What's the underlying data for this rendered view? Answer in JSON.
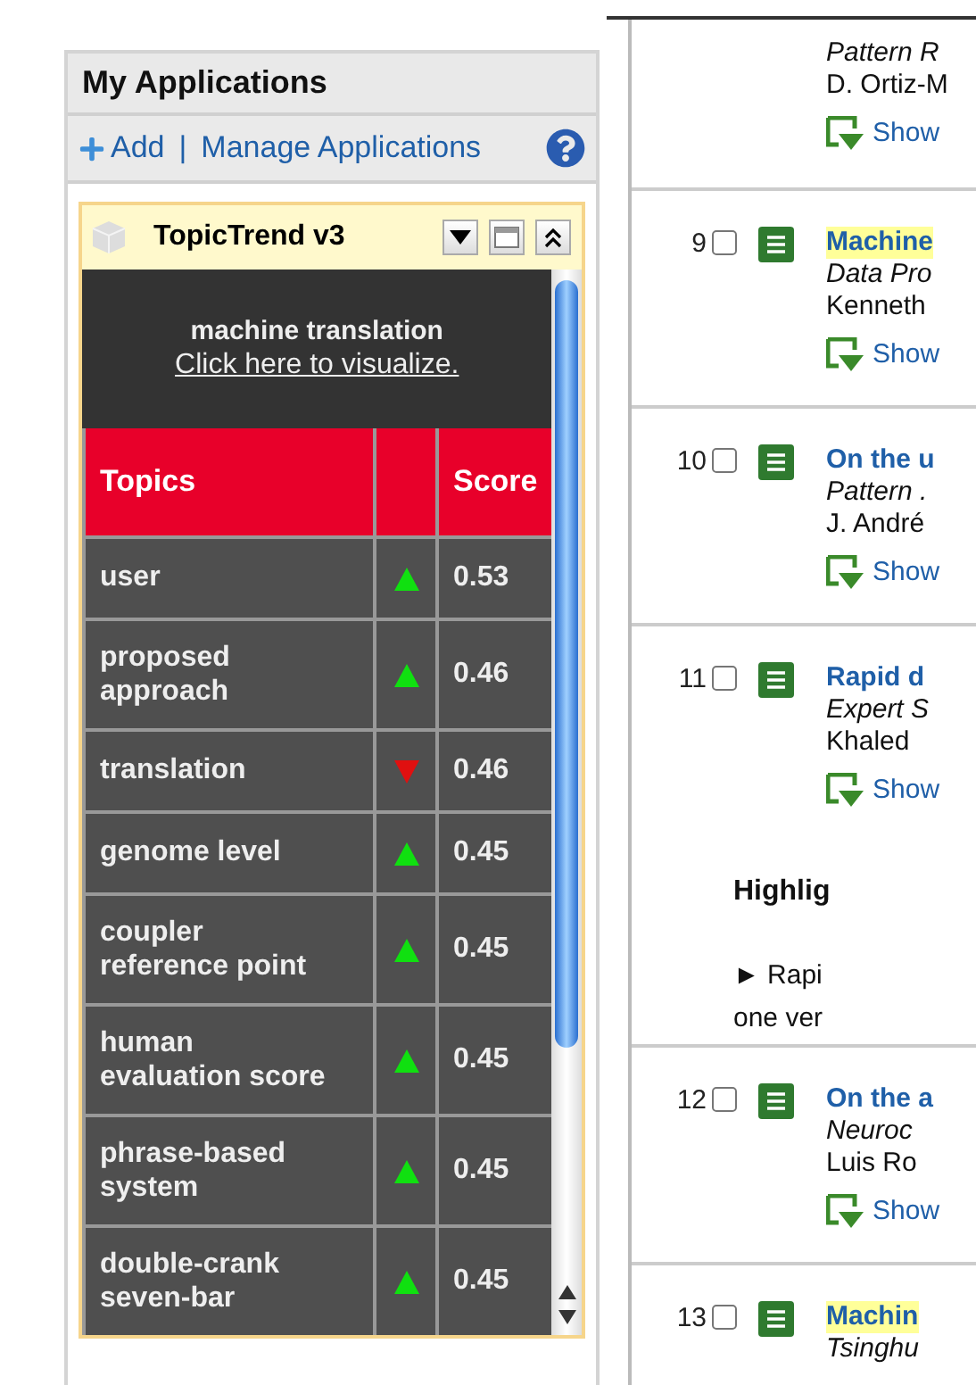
{
  "sidebar": {
    "title": "My Applications",
    "links": [
      {
        "kind": "add",
        "label": "Add"
      },
      {
        "kind": "manage",
        "label": "Manage Applications"
      }
    ],
    "separator": "|",
    "widget": {
      "title": "TopicTrend v3",
      "query": "machine translation",
      "visualize_link": "Click here to visualize.",
      "columns": [
        "Topics",
        "Score"
      ],
      "rows": [
        {
          "topic": [
            "user"
          ],
          "rising": true,
          "score": "0.53"
        },
        {
          "topic": [
            "proposed",
            "approach"
          ],
          "rising": true,
          "score": "0.46"
        },
        {
          "topic": [
            "translation"
          ],
          "rising": false,
          "score": "0.46"
        },
        {
          "topic": [
            "genome level"
          ],
          "rising": true,
          "score": "0.45"
        },
        {
          "topic": [
            "coupler",
            "reference point"
          ],
          "rising": true,
          "score": "0.45"
        },
        {
          "topic": [
            "human",
            "evaluation score"
          ],
          "rising": true,
          "score": "0.45"
        },
        {
          "topic": [
            "phrase-based",
            "system"
          ],
          "rising": true,
          "score": "0.45"
        },
        {
          "topic": [
            "double-crank",
            "seven-bar"
          ],
          "rising": true,
          "score": "0.45"
        }
      ]
    }
  },
  "results": [
    {
      "source": "Pattern R",
      "authors": "D. Ortiz-M",
      "show_link": "Show"
    },
    {
      "number": "9",
      "checked": false,
      "title": "Machine",
      "highlighted": true,
      "source": "Data Pro",
      "authors": "Kenneth",
      "show_link": "Show"
    },
    {
      "number": "10",
      "checked": false,
      "title": "On the u",
      "highlighted": false,
      "source": "Pattern .",
      "authors": "J. André",
      "show_link": "Show"
    },
    {
      "number": "11",
      "checked": false,
      "title": "Rapid d",
      "highlighted": false,
      "source": "Expert S",
      "authors": "Khaled",
      "show_link": "Show",
      "highlights": {
        "heading": "Highlig",
        "bullet": "►",
        "lines": [
          "Rapi",
          "one ver"
        ]
      }
    },
    {
      "number": "12",
      "checked": false,
      "title": "On the a",
      "highlighted": false,
      "source": "Neuroc",
      "authors": "Luis Ro",
      "show_link": "Show"
    },
    {
      "number": "13",
      "checked": false,
      "title": "Machin",
      "highlighted": true,
      "source": "Tsinghu"
    }
  ]
}
